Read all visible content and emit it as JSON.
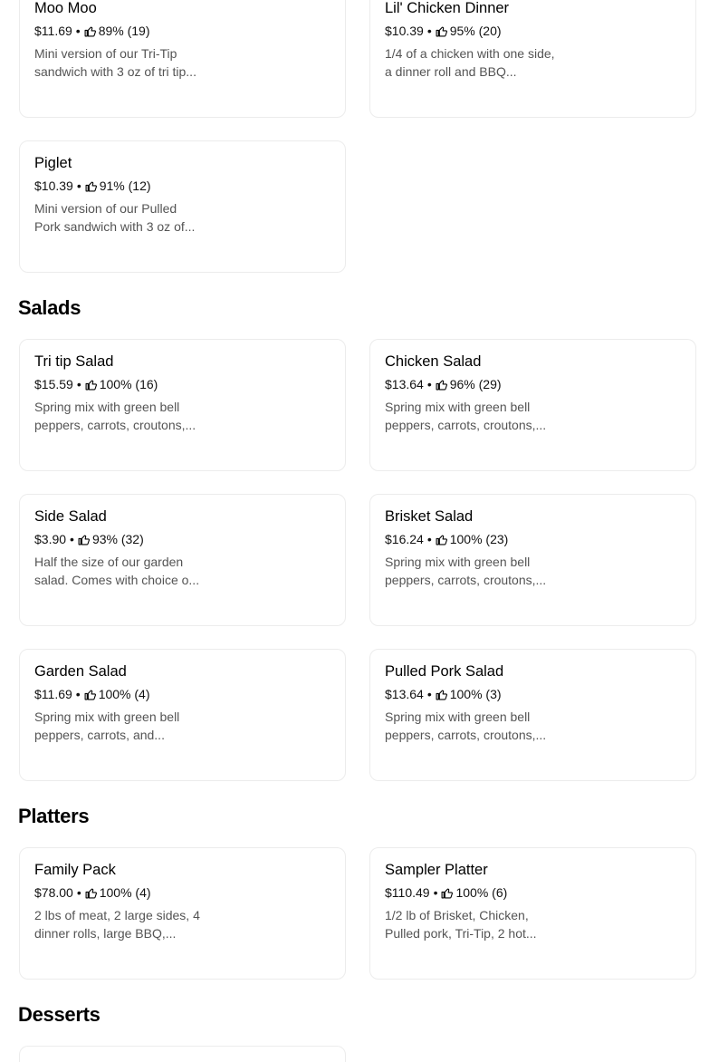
{
  "top_items": [
    {
      "name": "Moo Moo",
      "price": "$11.69",
      "rating": "89% (19)",
      "desc": "Mini version of our Tri-Tip sandwich with 3 oz of tri tip..."
    },
    {
      "name": "Lil' Chicken Dinner",
      "price": "$10.39",
      "rating": "95% (20)",
      "desc": "1/4 of a chicken with one side, a dinner roll and BBQ..."
    },
    {
      "name": "Piglet",
      "price": "$10.39",
      "rating": "91% (12)",
      "desc": "Mini version of our Pulled Pork sandwich with 3 oz of..."
    }
  ],
  "salads": {
    "title": "Salads",
    "items": [
      {
        "name": "Tri tip Salad",
        "price": "$15.59",
        "rating": "100% (16)",
        "desc": "Spring mix with green bell peppers, carrots, croutons,..."
      },
      {
        "name": "Chicken Salad",
        "price": "$13.64",
        "rating": "96% (29)",
        "desc": "Spring mix with green bell peppers, carrots, croutons,..."
      },
      {
        "name": "Side Salad",
        "price": "$3.90",
        "rating": "93% (32)",
        "desc": "Half the size of our garden salad. Comes with choice o..."
      },
      {
        "name": "Brisket Salad",
        "price": "$16.24",
        "rating": "100% (23)",
        "desc": "Spring mix with green bell peppers, carrots, croutons,..."
      },
      {
        "name": "Garden Salad",
        "price": "$11.69",
        "rating": "100% (4)",
        "desc": "Spring mix with green bell peppers, carrots, and..."
      },
      {
        "name": "Pulled Pork Salad",
        "price": "$13.64",
        "rating": "100% (3)",
        "desc": "Spring mix with green bell peppers, carrots, croutons,..."
      }
    ]
  },
  "platters": {
    "title": "Platters",
    "items": [
      {
        "name": "Family Pack",
        "price": "$78.00",
        "rating": "100% (4)",
        "desc": "2 lbs of meat, 2 large sides, 4 dinner rolls, large BBQ,..."
      },
      {
        "name": "Sampler Platter",
        "price": "$110.49",
        "rating": "100% (6)",
        "desc": "1/2 lb of Brisket, Chicken, Pulled pork, Tri-Tip, 2 hot..."
      }
    ]
  },
  "desserts": {
    "title": "Desserts"
  },
  "separator": "•",
  "icons": {
    "rating": "thumbs-up-icon"
  }
}
